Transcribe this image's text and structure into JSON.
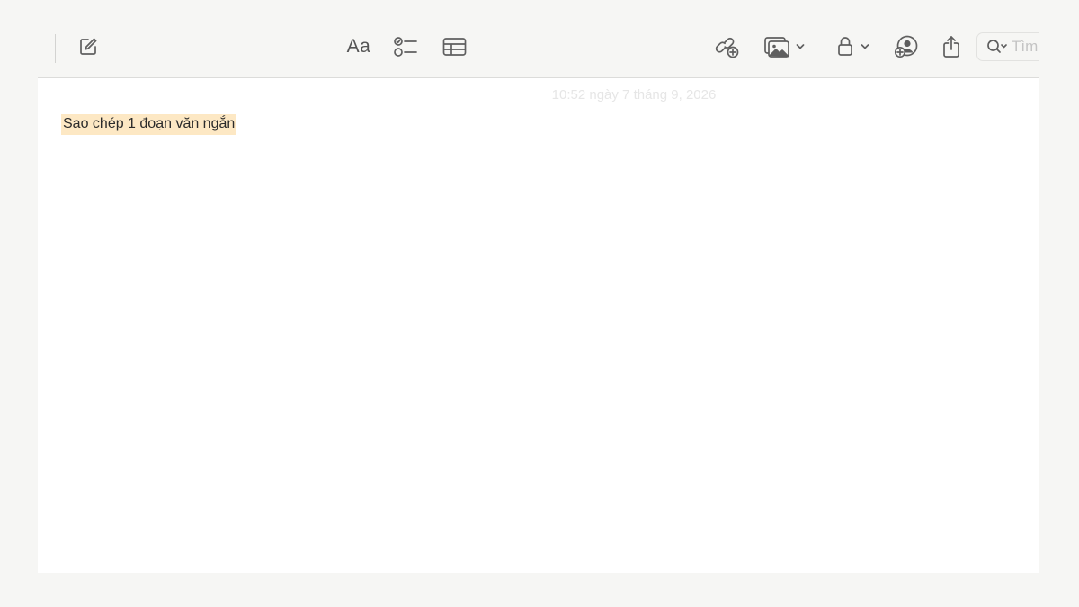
{
  "toolbar": {
    "format_label": "Aa",
    "search_placeholder": "Tìm",
    "icons": {
      "compose": "compose-icon",
      "format": "text-format-icon",
      "checklist": "checklist-icon",
      "table": "table-icon",
      "link": "add-link-icon",
      "media": "photo-icon",
      "lock": "lock-icon",
      "collaborate": "add-person-icon",
      "share": "share-icon",
      "search": "search-icon"
    }
  },
  "note": {
    "timestamp": "10:52 ngày 7 tháng 9, 2026",
    "text": "Sao chép 1 đoạn văn ngắn",
    "highlight_color": "#fde8c4"
  }
}
